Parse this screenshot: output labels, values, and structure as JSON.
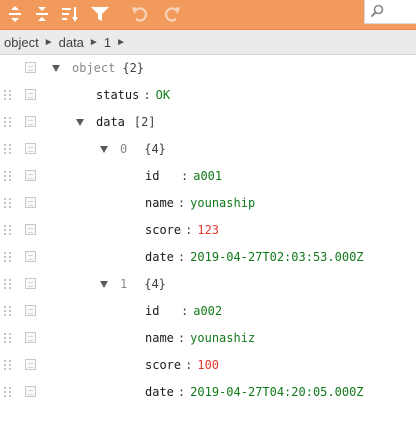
{
  "toolbar": {
    "buttons": [
      {
        "name": "expand-all-icon"
      },
      {
        "name": "collapse-all-icon"
      },
      {
        "name": "sort-icon"
      },
      {
        "name": "filter-icon"
      },
      {
        "name": "undo-icon"
      },
      {
        "name": "redo-icon"
      }
    ],
    "accent_color": "#f29a5c"
  },
  "navbar": {
    "path": [
      "object",
      "data",
      "1"
    ],
    "separator": "►"
  },
  "tree": {
    "root": {
      "label": "object",
      "count": "{2}"
    },
    "status": {
      "key": "status",
      "sep": ":",
      "value": "OK"
    },
    "data": {
      "key": "data",
      "count": "[2]"
    },
    "items": [
      {
        "index": "0",
        "count": "{4}",
        "fields": [
          {
            "key": "id",
            "sep": ":",
            "value": "a001"
          },
          {
            "key": "name",
            "sep": ":",
            "value": "younaship"
          },
          {
            "key": "score",
            "sep": ":",
            "value": "123"
          },
          {
            "key": "date",
            "sep": ":",
            "value": "2019-04-27T02:03:53.000Z"
          }
        ]
      },
      {
        "index": "1",
        "count": "{4}",
        "fields": [
          {
            "key": "id",
            "sep": ":",
            "value": "a002"
          },
          {
            "key": "name",
            "sep": ":",
            "value": "younashiz"
          },
          {
            "key": "score",
            "sep": ":",
            "value": "100"
          },
          {
            "key": "date",
            "sep": ":",
            "value": "2019-04-27T04:20:05.000Z"
          }
        ]
      }
    ]
  }
}
